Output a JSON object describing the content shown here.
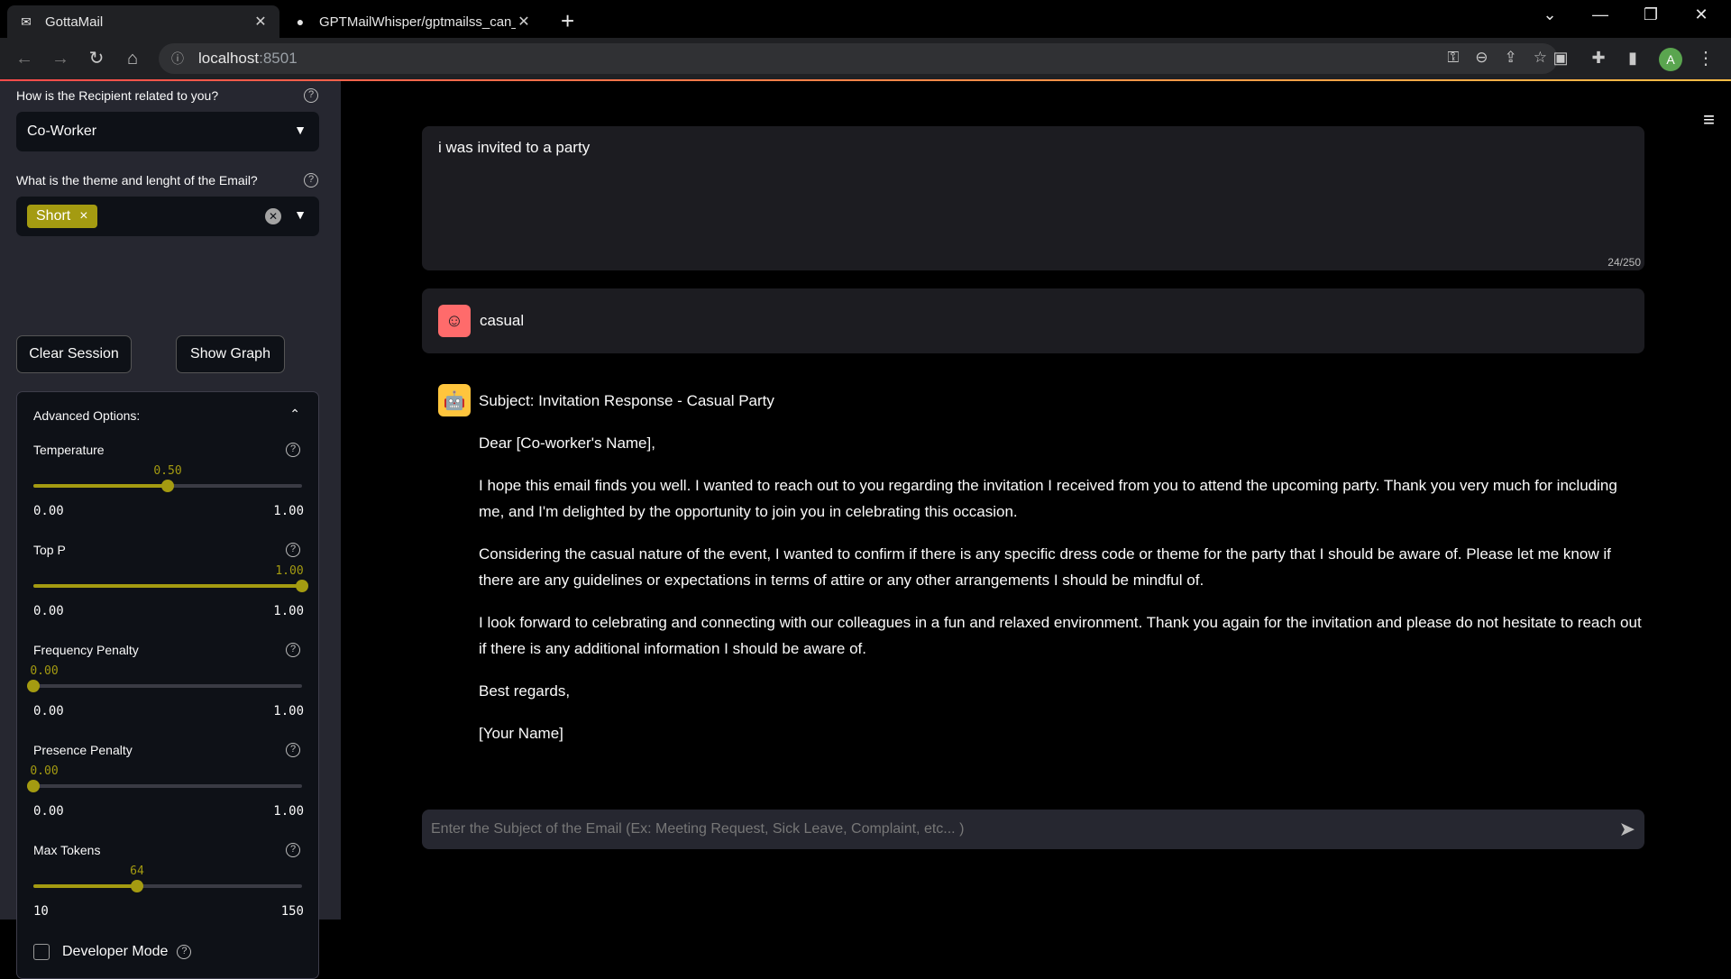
{
  "browser": {
    "tabs": [
      {
        "title": "GottaMail",
        "active": true
      },
      {
        "title": "GPTMailWhisper/gptmailss_can_c",
        "active": false
      }
    ],
    "url_host": "localhost",
    "url_port": ":8501",
    "profile_initial": "A"
  },
  "sidebar": {
    "relation": {
      "label": "How is the Recipient related to you?",
      "value": "Co-Worker"
    },
    "theme": {
      "label": "What is the theme and lenght of the Email?",
      "chips": [
        "Short"
      ]
    },
    "buttons": {
      "clear": "Clear Session",
      "graph": "Show Graph"
    },
    "advanced": {
      "title": "Advanced Options:",
      "sliders": [
        {
          "label": "Temperature",
          "value": "0.50",
          "min": "0.00",
          "max": "1.00",
          "fraction": 0.5
        },
        {
          "label": "Top P",
          "value": "1.00",
          "min": "0.00",
          "max": "1.00",
          "fraction": 1.0
        },
        {
          "label": "Frequency Penalty",
          "value": "0.00",
          "min": "0.00",
          "max": "1.00",
          "fraction": 0.0
        },
        {
          "label": "Presence Penalty",
          "value": "0.00",
          "min": "0.00",
          "max": "1.00",
          "fraction": 0.0
        },
        {
          "label": "Max Tokens",
          "value": "64",
          "min": "10",
          "max": "150",
          "fraction": 0.3857
        }
      ],
      "developer_mode": "Developer Mode"
    }
  },
  "chat": {
    "user_message": "i was invited to a party",
    "char_count": "24/250",
    "tone_message": "casual",
    "bot_paragraphs": [
      "Subject: Invitation Response - Casual Party",
      "Dear [Co-worker's Name],",
      "I hope this email finds you well. I wanted to reach out to you regarding the invitation I received from you to attend the upcoming party. Thank you very much for including me, and I'm delighted by the opportunity to join you in celebrating this occasion.",
      "Considering the casual nature of the event, I wanted to confirm if there is any specific dress code or theme for the party that I should be aware of. Please let me know if there are any guidelines or expectations in terms of attire or any other arrangements I should be mindful of.",
      "I look forward to celebrating and connecting with our colleagues in a fun and relaxed environment. Thank you again for the invitation and please do not hesitate to reach out if there is any additional information I should be aware of.",
      "Best regards,",
      "[Your Name]"
    ],
    "input_placeholder": "Enter the Subject of the Email (Ex: Meeting Request, Sick Leave, Complaint, etc... )"
  },
  "colors": {
    "accent": "#a49b11",
    "sidebar_bg": "#262730",
    "main_bg": "#000000",
    "user_avatar": "#ff6b6b",
    "bot_avatar": "#ffc53d"
  }
}
